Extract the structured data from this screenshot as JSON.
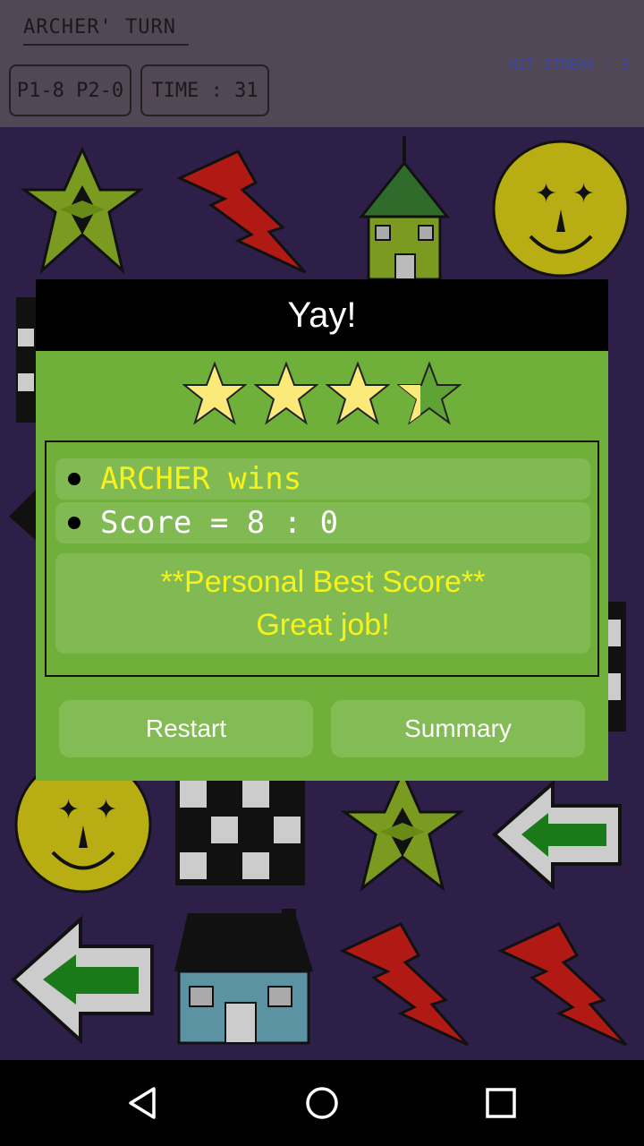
{
  "header": {
    "turn_label": "ARCHER' TURN",
    "score_label": "P1-8 P2-0",
    "time_label": "TIME : 31",
    "streak_label": "HIT STREAK : 3"
  },
  "board": {
    "tiles": [
      "star-icon",
      "lightning-icon",
      "house-icon",
      "smiley-icon",
      "checker-icon",
      "arrow-icon"
    ]
  },
  "dialog": {
    "title": "Yay!",
    "rating": {
      "filled": 3.5,
      "max": 4
    },
    "result_lines": [
      "ARCHER wins",
      "Score = 8 : 0"
    ],
    "message_lines": [
      "**Personal Best Score**",
      "Great job!"
    ],
    "buttons": {
      "restart": "Restart",
      "summary": "Summary"
    }
  },
  "navbar": {
    "icons": [
      "back-icon",
      "home-icon",
      "recents-icon"
    ]
  },
  "colors": {
    "dialog_bg": "#6fb03a",
    "winner_text": "#f6f21a",
    "message_text": "#f6f21a",
    "board_bg": "#2e1f48",
    "header_bg": "#524754"
  }
}
